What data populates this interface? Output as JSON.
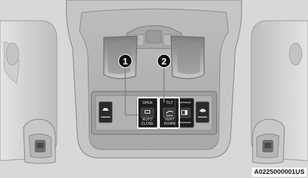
{
  "callouts": [
    "1",
    "2"
  ],
  "left_switch": {
    "top_label": "OPEN",
    "middle_label": "AUTO",
    "bottom_label": "CLOSE"
  },
  "right_switch": {
    "top_label": "TILT",
    "middle_label": "VENT",
    "bottom_label": "DOWN"
  },
  "figure_code": "A0225000001US",
  "icons": [
    "sunroof-icon",
    "vent-icon",
    "shade-icon",
    "dome-light-icon",
    "reading-light-icon"
  ],
  "colors": {
    "background": "#d6d6d6",
    "console": "#b4b4b4",
    "switch_panel": "#1a1a1a",
    "callout": "#111111"
  }
}
